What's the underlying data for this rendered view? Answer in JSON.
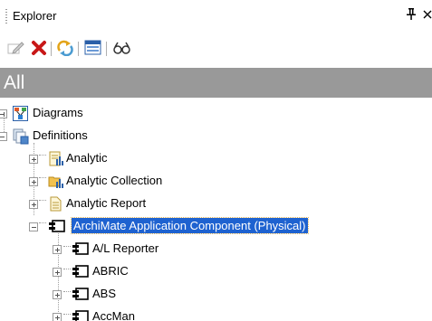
{
  "panel": {
    "title": "Explorer",
    "pin_glyph": "p",
    "close_glyph": "×"
  },
  "toolbar": {
    "buttons": [
      {
        "icon": "edit-icon"
      },
      {
        "icon": "delete-icon"
      },
      {
        "icon": "refresh-icon"
      },
      {
        "icon": "properties-window-icon"
      },
      {
        "icon": "find-binoculars-icon"
      }
    ]
  },
  "filter": {
    "label": "All"
  },
  "tree": {
    "diagrams": "Diagrams",
    "definitions": "Definitions",
    "analytic": "Analytic",
    "analytic_collection": "Analytic Collection",
    "analytic_report": "Analytic Report",
    "archimate_component": "ArchiMate Application Component (Physical)",
    "children": [
      "A/L Reporter",
      "ABRIC",
      "ABS",
      "AccMan"
    ]
  },
  "colors": {
    "selection": "#1e62d0",
    "filter_bar": "#999999"
  }
}
